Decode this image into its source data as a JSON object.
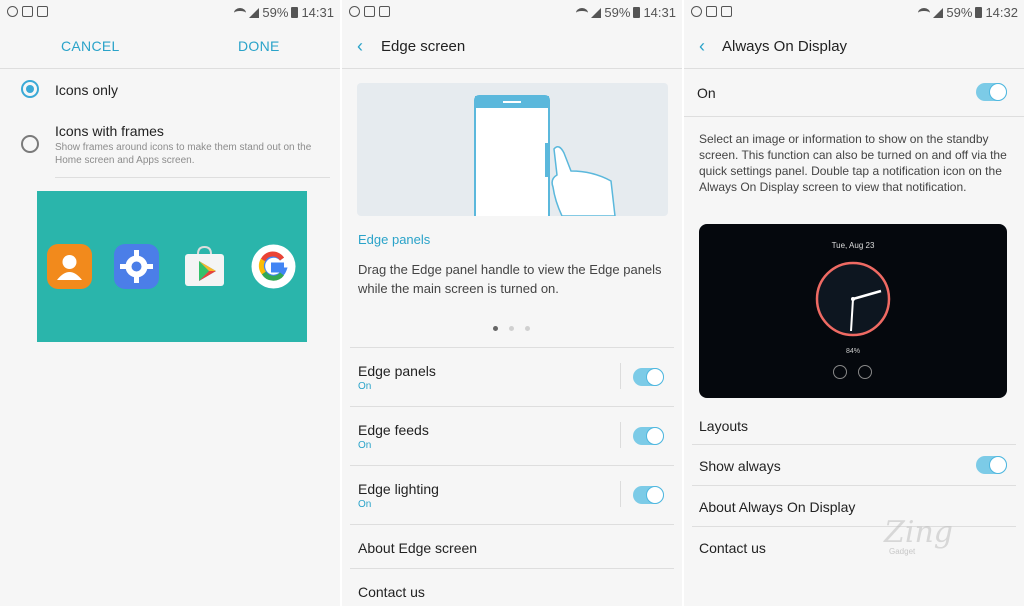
{
  "panel1": {
    "status": {
      "battery": "59%",
      "time": "14:31"
    },
    "cancel_label": "CANCEL",
    "done_label": "DONE",
    "options": [
      {
        "label": "Icons only",
        "selected": true,
        "description": ""
      },
      {
        "label": "Icons with frames",
        "selected": false,
        "description": "Show frames around icons to make them stand out on the Home screen and Apps screen."
      }
    ],
    "preview_bg": "#2ab5ab",
    "preview_icons": [
      "contacts-icon",
      "settings-icon",
      "play-store-icon",
      "google-icon"
    ]
  },
  "panel2": {
    "status": {
      "battery": "59%",
      "time": "14:31"
    },
    "title": "Edge screen",
    "section_link": "Edge panels",
    "description": "Drag the Edge panel handle to view the Edge panels while the main screen is turned on.",
    "carousel": {
      "count": 3,
      "active": 1
    },
    "rows": [
      {
        "title": "Edge panels",
        "sub": "On",
        "toggle": true
      },
      {
        "title": "Edge feeds",
        "sub": "On",
        "toggle": true
      },
      {
        "title": "Edge lighting",
        "sub": "On",
        "toggle": true
      },
      {
        "title": "About Edge screen"
      },
      {
        "title": "Contact us"
      }
    ]
  },
  "panel3": {
    "status": {
      "battery": "59%",
      "time": "14:32"
    },
    "title": "Always On Display",
    "master": {
      "label": "On",
      "toggle": true
    },
    "description": "Select an image or information to show on the standby screen. This function can also be turned on and off via the quick settings panel. Double tap a notification icon on the Always On Display screen to view that notification.",
    "preview": {
      "date": "Tue, Aug 23",
      "battery": "84%"
    },
    "rows": [
      {
        "title": "Layouts"
      },
      {
        "title": "Show always",
        "toggle": true
      },
      {
        "title": "About Always On Display"
      },
      {
        "title": "Contact us"
      }
    ],
    "watermark": "Zing",
    "watermark_sub": "Gadget"
  },
  "accent_color": "#2aa3c9"
}
